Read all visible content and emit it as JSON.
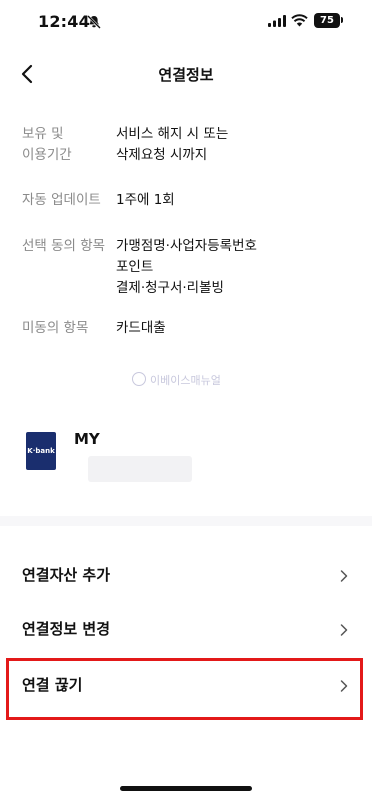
{
  "status_bar": {
    "time": "12:44",
    "battery": "75"
  },
  "header": {
    "title": "연결정보"
  },
  "info": [
    {
      "label": "보유 및\n이용기간",
      "value": "서비스 해지 시 또는\n삭제요청 시까지"
    },
    {
      "label": "자동 업데이트",
      "value": "1주에 1회"
    },
    {
      "label": "선택 동의 항목",
      "value": "가맹점명·사업자등록번호\n포인트\n결제·청구서·리볼빙"
    },
    {
      "label": "미동의 항목",
      "value": "카드대출"
    }
  ],
  "watermark": "이베이스매뉴얼",
  "account": {
    "logo_text": "K·bank",
    "name": "MY"
  },
  "menu": [
    {
      "label": "연결자산 추가"
    },
    {
      "label": "연결정보 변경"
    },
    {
      "label": "연결 끊기"
    }
  ],
  "colors": {
    "highlight": "#e31919",
    "bank_brand": "#1a2e6e"
  }
}
